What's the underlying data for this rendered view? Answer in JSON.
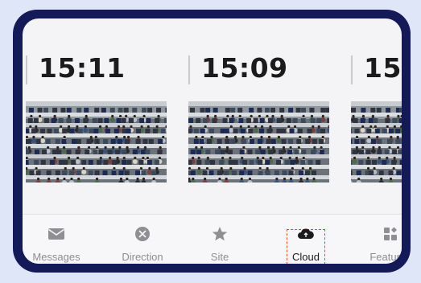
{
  "clips": [
    {
      "time": "15:11"
    },
    {
      "time": "15:09"
    },
    {
      "time": "15"
    }
  ],
  "tabs": [
    {
      "label": "Messages",
      "icon": "envelope-icon"
    },
    {
      "label": "Direction",
      "icon": "direction-icon"
    },
    {
      "label": "Site",
      "icon": "star-icon"
    },
    {
      "label": "Cloud",
      "icon": "cloud-icon"
    },
    {
      "label": "Features",
      "icon": "grid-icon"
    }
  ],
  "selected_tab": "Cloud",
  "colors": {
    "frame": "#141a57",
    "highlight": "#e24b3a",
    "inactive": "#8e8e93"
  }
}
